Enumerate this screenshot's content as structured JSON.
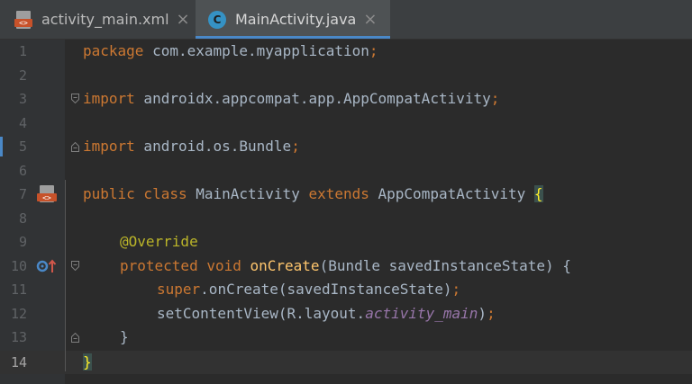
{
  "tabs": [
    {
      "label": "activity_main.xml",
      "close": "×",
      "icon": "xml-file-icon",
      "icon_text": "<>",
      "active": false
    },
    {
      "label": "MainActivity.java",
      "close": "×",
      "icon": "java-class-icon",
      "icon_text": "C",
      "active": true
    }
  ],
  "editor": {
    "current_line": 14,
    "line_numbers": [
      "1",
      "2",
      "3",
      "4",
      "5",
      "6",
      "7",
      "8",
      "9",
      "10",
      "11",
      "12",
      "13",
      "14"
    ],
    "lines": {
      "l1_kw": "package",
      "l1_rest": " com.example.myapplication",
      "l1_semi": ";",
      "l3_kw": "import",
      "l3_rest": " androidx.appcompat.app.AppCompatActivity",
      "l3_semi": ";",
      "l5_kw": "import",
      "l5_rest": " android.os.Bundle",
      "l5_semi": ";",
      "l7_kw1": "public class",
      "l7_name": " MainActivity ",
      "l7_kw2": "extends",
      "l7_rest": " AppCompatActivity ",
      "l7_brace": "{",
      "l9_ann": "@Override",
      "l10_kw": "protected void",
      "l10_fn": " onCreate",
      "l10_rest": "(Bundle savedInstanceState) {",
      "l11_kw": "super",
      "l11_rest": ".onCreate(savedInstanceState)",
      "l11_semi": ";",
      "l12_pre": "setContentView(R.layout.",
      "l12_fld": "activity_main",
      "l12_post": ")",
      "l12_semi": ";",
      "l13": "}",
      "l14": "}"
    }
  },
  "gutter_icons": {
    "line7": "xml-layout-icon",
    "line10": "override-method-icon"
  },
  "colors": {
    "background": "#2b2b2b",
    "keyword": "#cc7832",
    "annotation": "#bbb529",
    "method": "#ffc66d",
    "field": "#9876aa",
    "text": "#a9b7c6",
    "accent": "#4a88c7"
  }
}
